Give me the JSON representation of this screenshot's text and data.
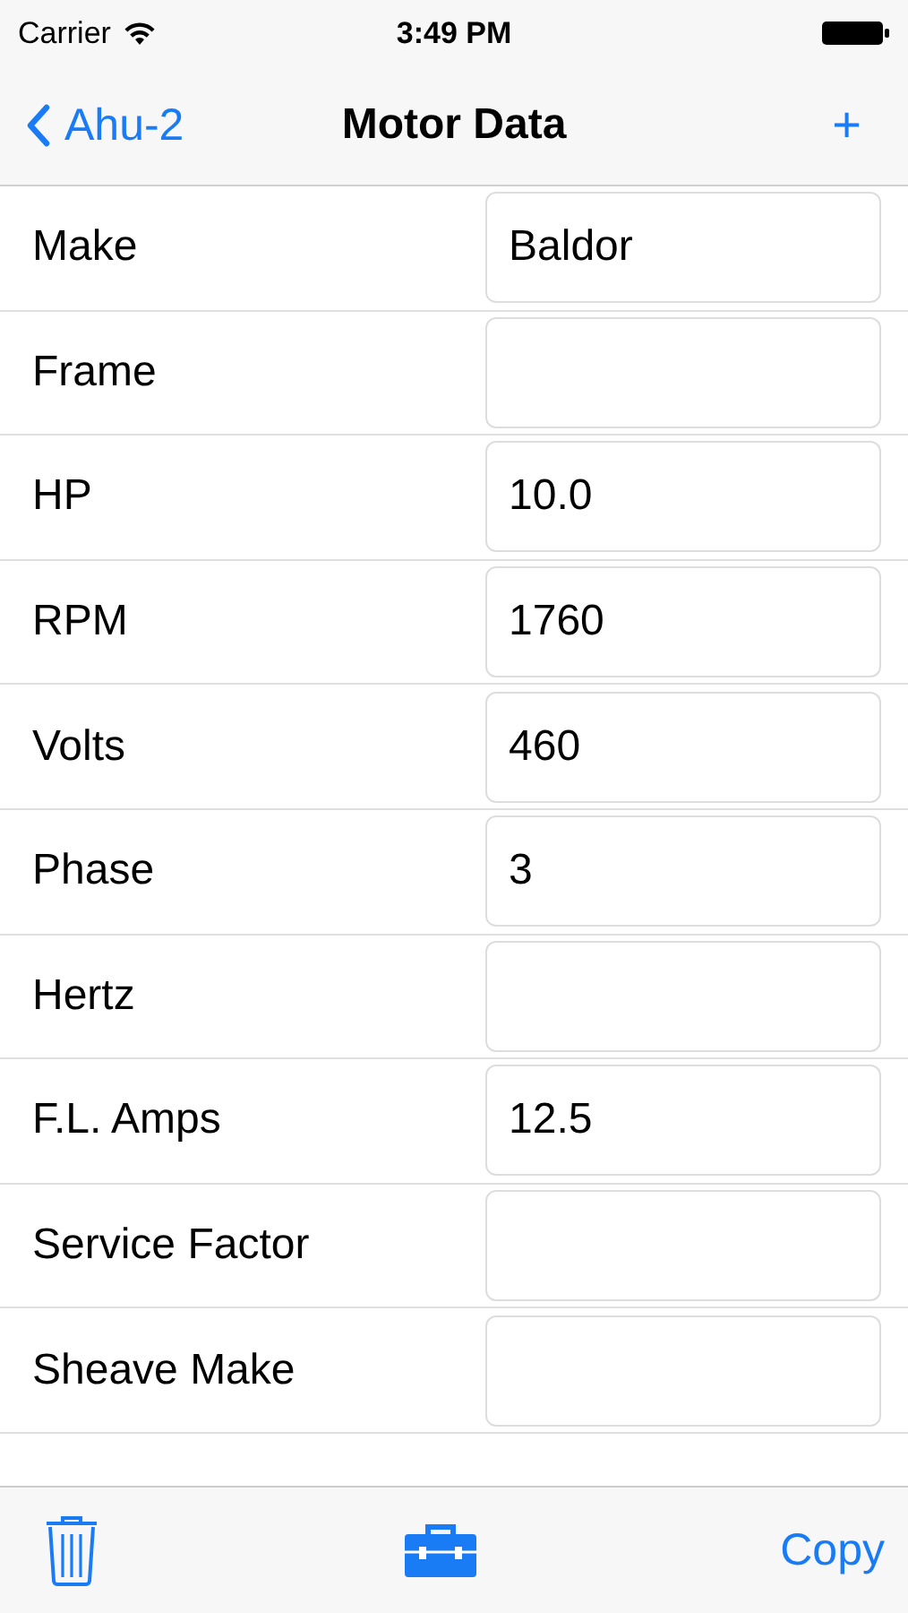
{
  "status_bar": {
    "carrier": "Carrier",
    "time": "3:49 PM"
  },
  "nav_bar": {
    "back": "Ahu-2",
    "title": "Motor Data",
    "add": "+"
  },
  "fields": [
    {
      "label": "Make",
      "value": "Baldor"
    },
    {
      "label": "Frame"
    },
    {
      "label": "HP",
      "value": "10.0"
    },
    {
      "label": "RPM",
      "value": "1760"
    },
    {
      "label": "Volts",
      "value": "460"
    },
    {
      "label": "Phase",
      "value": "3"
    },
    {
      "label": "Hertz"
    },
    {
      "label": "F.L. Amps",
      "value": "12.5"
    },
    {
      "label": "Service Factor"
    },
    {
      "label": "Sheave Make"
    }
  ],
  "toolbar": {
    "copy": "Copy"
  }
}
